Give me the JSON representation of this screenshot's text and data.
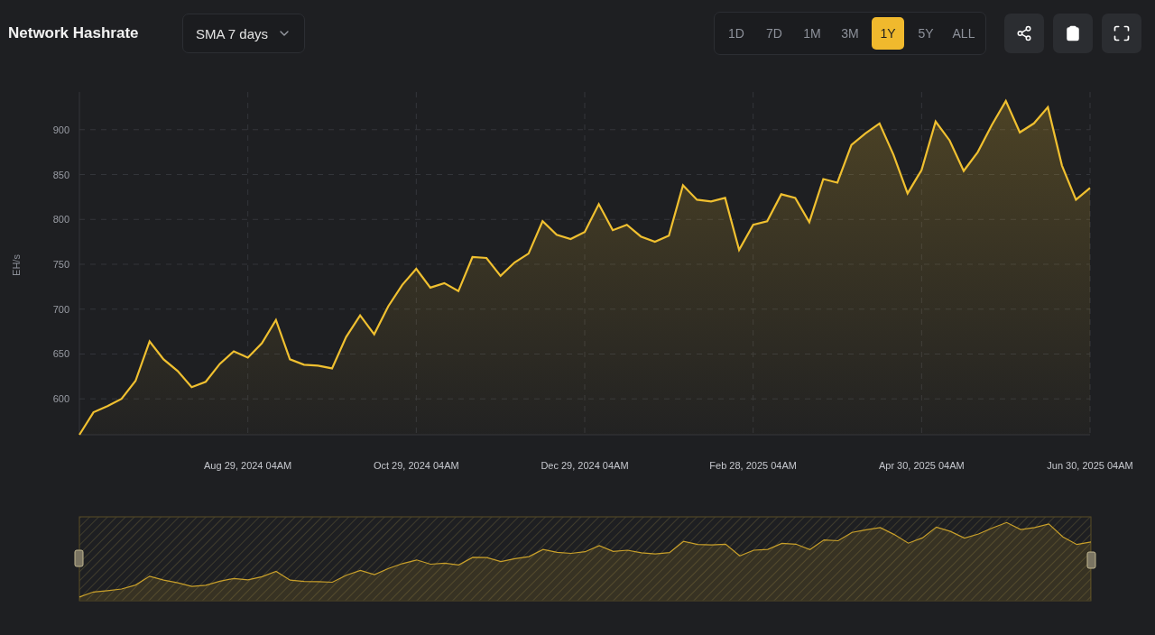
{
  "header": {
    "title": "Network Hashrate",
    "average_select": {
      "value": "SMA 7 days"
    }
  },
  "ranges": [
    {
      "label": "1D",
      "selected": false
    },
    {
      "label": "7D",
      "selected": false
    },
    {
      "label": "1M",
      "selected": false
    },
    {
      "label": "3M",
      "selected": false
    },
    {
      "label": "1Y",
      "selected": true
    },
    {
      "label": "5Y",
      "selected": false
    },
    {
      "label": "ALL",
      "selected": false
    }
  ],
  "chart": {
    "chart_data": {
      "type": "area",
      "grid": true,
      "ylabel": "EH/s",
      "ylim": [
        560,
        942
      ],
      "yticks": [
        600,
        650,
        700,
        750,
        800,
        850,
        900
      ],
      "categories": [
        null,
        null,
        null,
        null,
        null,
        null,
        null,
        null,
        null,
        null,
        null,
        null,
        "Aug 29, 2024 04AM",
        null,
        null,
        null,
        null,
        null,
        null,
        null,
        null,
        null,
        null,
        null,
        "Oct 29, 2024 04AM",
        null,
        null,
        null,
        null,
        null,
        null,
        null,
        null,
        null,
        null,
        null,
        "Dec 29, 2024 04AM",
        null,
        null,
        null,
        null,
        null,
        null,
        null,
        null,
        null,
        null,
        null,
        "Feb 28, 2025 04AM",
        null,
        null,
        null,
        null,
        null,
        null,
        null,
        null,
        null,
        null,
        null,
        "Apr 30, 2025 04AM",
        null,
        null,
        null,
        null,
        null,
        null,
        null,
        null,
        null,
        null,
        null,
        "Jun 30, 2025 04AM"
      ],
      "series": [
        {
          "color": "#f0c030",
          "values": [
            560,
            585,
            592,
            600,
            620,
            664,
            644,
            631,
            613,
            619,
            639,
            653,
            646,
            662,
            688,
            644,
            638,
            637,
            634,
            669,
            693,
            672,
            703,
            727,
            745,
            724,
            729,
            720,
            758,
            757,
            737,
            752,
            762,
            798,
            783,
            778,
            786,
            817,
            788,
            794,
            781,
            775,
            782,
            838,
            822,
            820,
            824,
            766,
            794,
            798,
            828,
            824,
            797,
            845,
            841,
            883,
            896,
            907,
            872,
            829,
            855,
            909,
            888,
            854,
            875,
            905,
            932,
            897,
            907,
            925,
            860,
            822,
            835
          ]
        }
      ]
    }
  }
}
